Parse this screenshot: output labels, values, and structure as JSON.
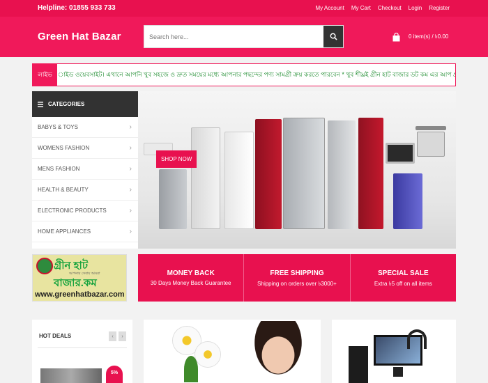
{
  "topbar": {
    "helpline": "Helpline: 01855 933 733",
    "links": [
      "My Account",
      "My Cart",
      "Checkout",
      "Login",
      "Register"
    ]
  },
  "header": {
    "brand": "Green Hat Bazar",
    "search_placeholder": "Search here...",
    "cart_text": "0 item(s) / ৳0.00"
  },
  "ticker": {
    "label": "লাইভ",
    "text": "াইড ওয়েবসাইট। এখানে আপনি খুব সহজে ও দ্রুত সময়ের মধ্যে আপনার পছন্দের পণ্য সামগ্রী ক্রয় করতে পারবেন * খুব শীঘ্রই গ্রীন হাট বাজার ডট কম এর আপ প্রতিষ্ঠাপন হতে যাচ্ছে সে প"
  },
  "categories": {
    "heading": "CATEGORIES",
    "items": [
      "BABYS & TOYS",
      "WOMENS FASHION",
      "MENS FASHION",
      "HEALTH & BEAUTY",
      "ELECTRONIC PRODUCTS",
      "HOME APPLIANCES"
    ]
  },
  "banner": {
    "button": "SHOP NOW"
  },
  "promo_logo": {
    "title": "গ্রীন হাট বাজার.কম",
    "tagline": "আপনার সেবায় আমরা",
    "url": "www.greenhatbazar.com"
  },
  "features": [
    {
      "title": "MONEY BACK",
      "desc": "30 Days Money Back Guarantee"
    },
    {
      "title": "FREE SHIPPING",
      "desc": "Shipping on orders over ৳3000+"
    },
    {
      "title": "SPECIAL SALE",
      "desc": "Extra ৳5 off on all items"
    }
  ],
  "hot_deals": {
    "title": "HOT DEALS",
    "badge": "5%"
  },
  "colors": {
    "brand": "#f0195a",
    "topbar": "#e8114f",
    "dark": "#323232",
    "ticker_text": "#1a8a2c"
  },
  "icons": [
    "search-icon",
    "cart-icon",
    "menu-icon",
    "chevron-right-icon",
    "chevron-left-icon"
  ]
}
